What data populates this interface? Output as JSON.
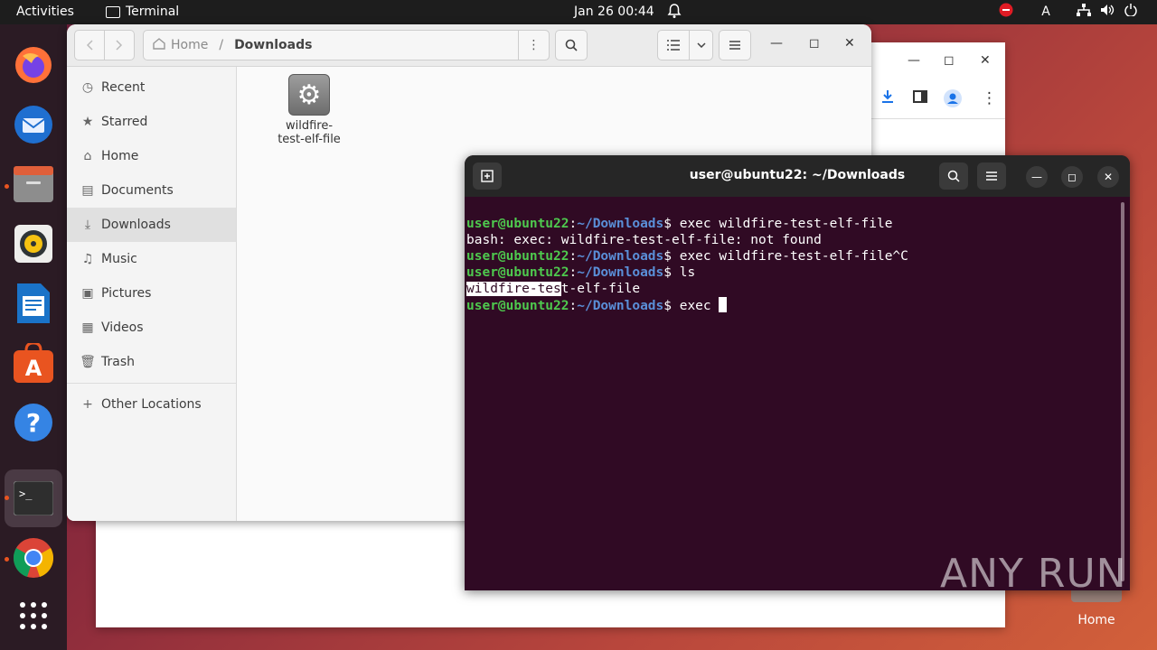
{
  "topbar": {
    "activities": "Activities",
    "app_name": "Terminal",
    "datetime": "Jan 26  00:44",
    "tray_icons": [
      "stop-icon",
      "keyboard-icon",
      "network-icon",
      "volume-icon",
      "power-icon"
    ],
    "keyboard": "A"
  },
  "dock": {
    "items": [
      "Firefox",
      "Thunderbird",
      "Files",
      "Rhythmbox",
      "LibreOffice Writer",
      "Ubuntu Software",
      "Help",
      "Terminal",
      "Google Chrome",
      "Show Applications"
    ]
  },
  "files": {
    "path": {
      "home": "Home",
      "separator": "/",
      "current": "Downloads"
    },
    "sidebar": {
      "items": [
        {
          "label": "Recent",
          "icon": "clock-icon"
        },
        {
          "label": "Starred",
          "icon": "star-icon"
        },
        {
          "label": "Home",
          "icon": "home-icon"
        },
        {
          "label": "Documents",
          "icon": "document-icon"
        },
        {
          "label": "Downloads",
          "icon": "download-icon"
        },
        {
          "label": "Music",
          "icon": "music-icon"
        },
        {
          "label": "Pictures",
          "icon": "picture-icon"
        },
        {
          "label": "Videos",
          "icon": "video-icon"
        },
        {
          "label": "Trash",
          "icon": "trash-icon"
        }
      ],
      "other": "Other Locations"
    },
    "file": {
      "name_line1": "wildfire-",
      "name_line2": "test-elf-file"
    }
  },
  "terminal": {
    "title": "user@ubuntu22: ~/Downloads",
    "prompt_user": "user@ubuntu22",
    "prompt_path": "~/Downloads",
    "lines": [
      {
        "type": "prompt",
        "cmd": "$ exec wildfire-test-elf-file"
      },
      {
        "type": "out",
        "text": "bash: exec: wildfire-test-elf-file: not found"
      },
      {
        "type": "prompt",
        "cmd": "$ exec wildfire-test-elf-file^C"
      },
      {
        "type": "prompt",
        "cmd": "$ ls"
      },
      {
        "type": "sel",
        "selected": "wildfire-tes",
        "rest": "t-elf-file"
      },
      {
        "type": "prompt",
        "cmd": "$ exec "
      }
    ]
  },
  "desktop": {
    "home_label": "Home",
    "watermark": "ANY RUN"
  }
}
